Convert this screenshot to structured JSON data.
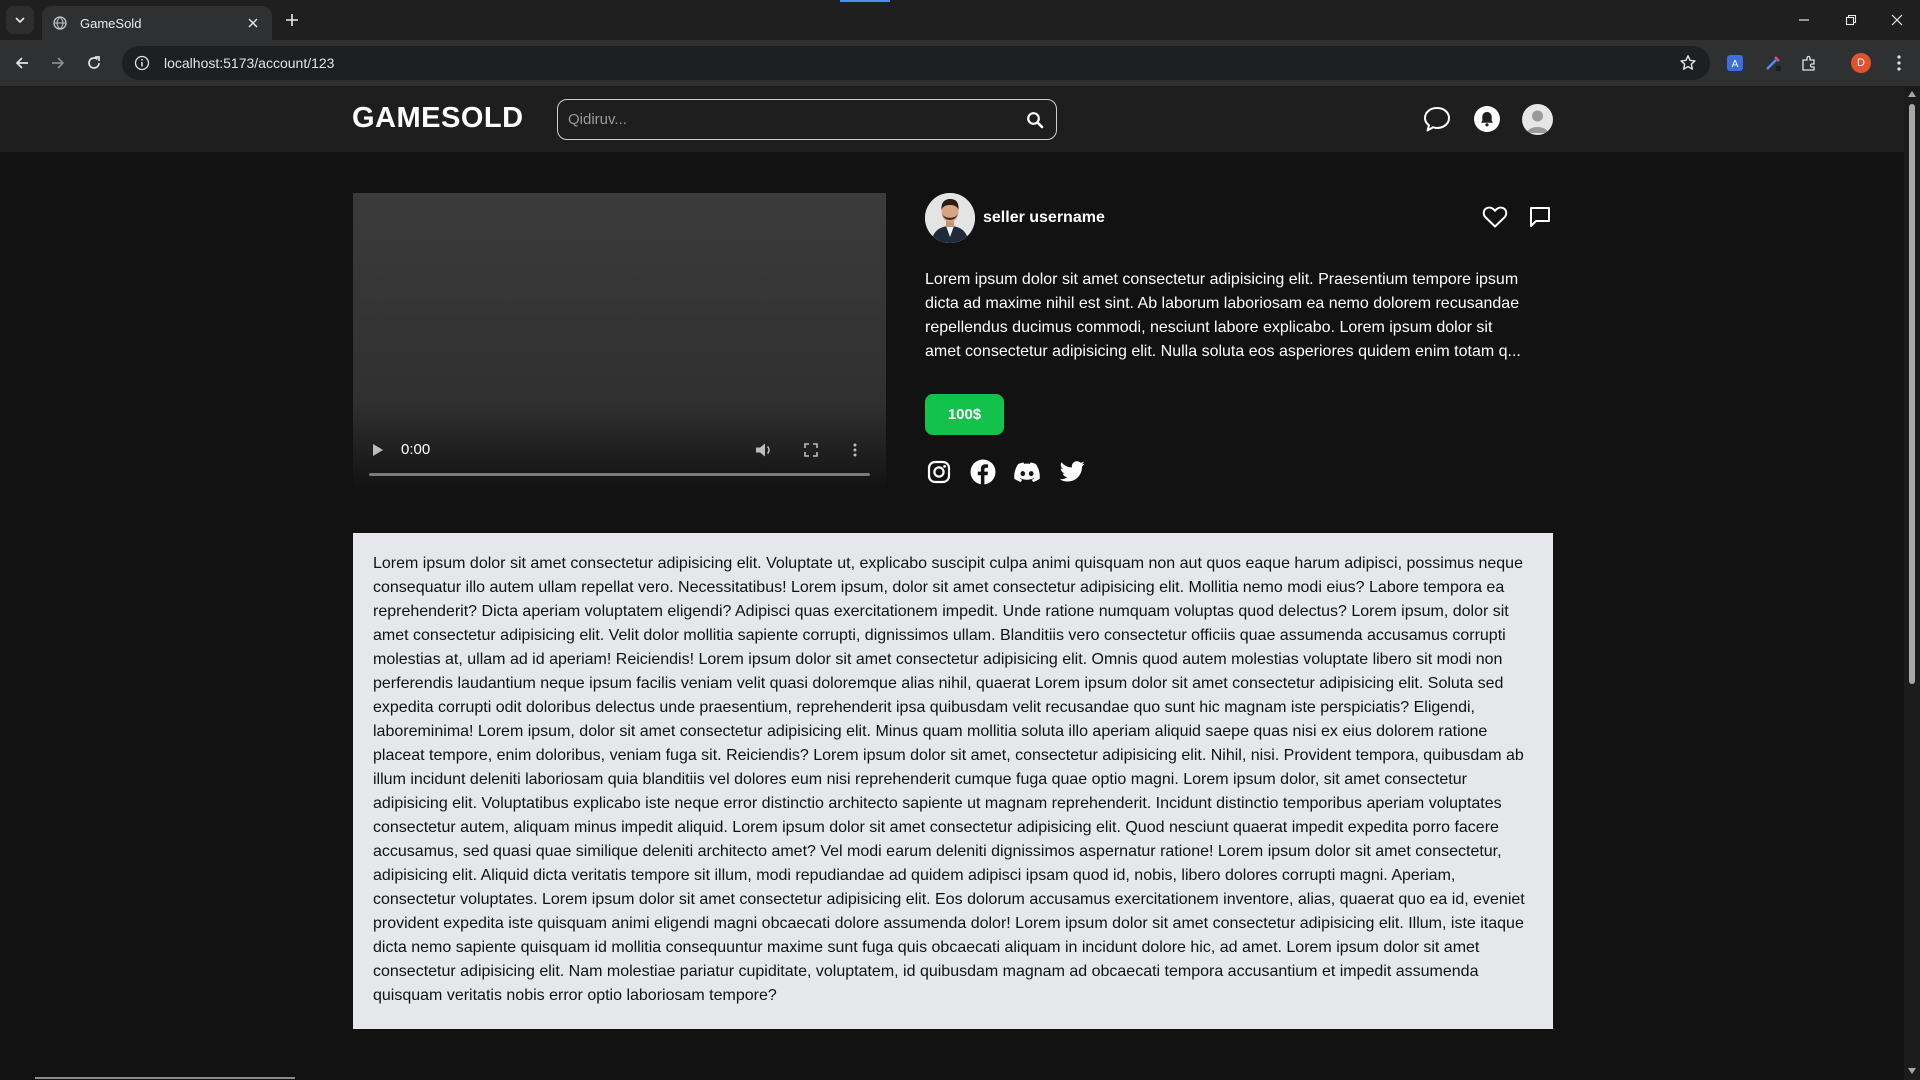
{
  "browser": {
    "tab_title": "GameSold",
    "url": "localhost:5173/account/123",
    "profile_initial": "D"
  },
  "header": {
    "logo": "GAMESOLD",
    "search_placeholder": "Qidiruv..."
  },
  "video": {
    "time": "0:00"
  },
  "seller": {
    "username": "seller username",
    "description": "Lorem ipsum dolor sit amet consectetur adipisicing elit. Praesentium tempore ipsum dicta ad maxime nihil est sint. Ab laborum laboriosam ea nemo dolorem recusandae repellendus ducimus commodi, nesciunt labore explicabo. Lorem ipsum dolor sit amet consectetur adipisicing elit. Nulla soluta eos asperiores quidem enim totam q...",
    "price": "100$"
  },
  "details": {
    "text": "Lorem ipsum dolor sit amet consectetur adipisicing elit. Voluptate ut, explicabo suscipit culpa animi quisquam non aut quos eaque harum adipisci, possimus neque consequatur illo autem ullam repellat vero. Necessitatibus! Lorem ipsum, dolor sit amet consectetur adipisicing elit. Mollitia nemo modi eius? Labore tempora ea reprehenderit? Dicta aperiam voluptatem eligendi? Adipisci quas exercitationem impedit. Unde ratione numquam voluptas quod delectus? Lorem ipsum, dolor sit amet consectetur adipisicing elit. Velit dolor mollitia sapiente corrupti, dignissimos ullam. Blanditiis vero consectetur officiis quae assumenda accusamus corrupti molestias at, ullam ad id aperiam! Reiciendis! Lorem ipsum dolor sit amet consectetur adipisicing elit. Omnis quod autem molestias voluptate libero sit modi non perferendis laudantium neque ipsum facilis veniam velit quasi doloremque alias nihil, quaerat Lorem ipsum dolor sit amet consectetur adipisicing elit. Soluta sed expedita corrupti odit doloribus delectus unde praesentium, reprehenderit ipsa quibusdam velit recusandae quo sunt hic magnam iste perspiciatis? Eligendi, laboreminima! Lorem ipsum, dolor sit amet consectetur adipisicing elit. Minus quam mollitia soluta illo aperiam aliquid saepe quas nisi ex eius dolorem ratione placeat tempore, enim doloribus, veniam fuga sit. Reiciendis? Lorem ipsum dolor sit amet, consectetur adipisicing elit. Nihil, nisi. Provident tempora, quibusdam ab illum incidunt deleniti laboriosam quia blanditiis vel dolores eum nisi reprehenderit cumque fuga quae optio magni. Lorem ipsum dolor, sit amet consectetur adipisicing elit. Voluptatibus explicabo iste neque error distinctio architecto sapiente ut magnam reprehenderit. Incidunt distinctio temporibus aperiam voluptates consectetur autem, aliquam minus impedit aliquid. Lorem ipsum dolor sit amet consectetur adipisicing elit. Quod nesciunt quaerat impedit expedita porro facere accusamus, sed quasi quae similique deleniti architecto amet? Vel modi earum deleniti dignissimos aspernatur ratione! Lorem ipsum dolor sit amet consectetur, adipisicing elit. Aliquid dicta veritatis tempore sit illum, modi repudiandae ad quidem adipisci ipsam quod id, nobis, libero dolores corrupti magni. Aperiam, consectetur voluptates. Lorem ipsum dolor sit amet consectetur adipisicing elit. Eos dolorum accusamus exercitationem inventore, alias, quaerat quo ea id, eveniet provident expedita iste quisquam animi eligendi magni obcaecati dolore assumenda dolor! Lorem ipsum dolor sit amet consectetur adipisicing elit. Illum, iste itaque dicta nemo sapiente quisquam id mollitia consequuntur maxime sunt fuga quis obcaecati aliquam in incidunt dolore hic, ad amet. Lorem ipsum dolor sit amet consectetur adipisicing elit. Nam molestiae pariatur cupiditate, voluptatem, id quibusdam magnam ad obcaecati tempora accusantium et impedit assumenda quisquam veritatis nobis error optio laboriosam tempore?"
  },
  "icons": {
    "chat": "chat-bubble-icon",
    "notifications": "bell-icon",
    "profile": "user-avatar-icon",
    "like": "heart-icon",
    "message": "message-square-icon",
    "socials": [
      "instagram-icon",
      "facebook-icon",
      "discord-icon",
      "twitter-icon"
    ]
  },
  "colors": {
    "page_bg": "#121212",
    "header_bg": "#1e1e1e",
    "price_bg": "#12c24a",
    "details_bg": "#e5e7eb"
  }
}
